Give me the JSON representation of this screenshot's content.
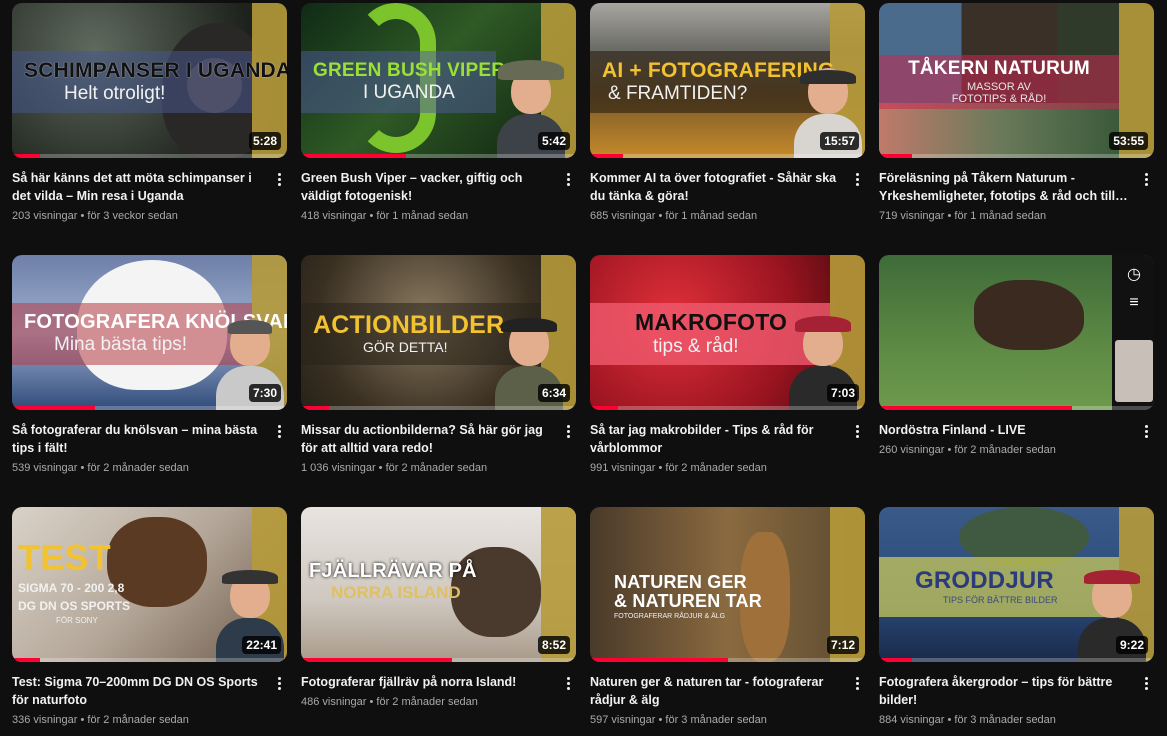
{
  "videos": [
    {
      "title": "Så här känns det att möta schimpanser i det vilda – Min resa i Uganda",
      "views": "203 visningar",
      "age": "för 3 veckor sedan",
      "duration": "5:28",
      "thumb_line1": "SCHIMPANSER I UGANDA",
      "thumb_line2": "Helt otroligt!",
      "progress": 0.1
    },
    {
      "title": "Green Bush Viper – vacker, giftig och väldigt fotogenisk!",
      "views": "418 visningar",
      "age": "för 1 månad sedan",
      "duration": "5:42",
      "thumb_line1": "GREEN BUSH VIPER",
      "thumb_line2": "I UGANDA",
      "progress": 0.38
    },
    {
      "title": "Kommer AI ta över fotografiet - Såhär ska du tänka & göra!",
      "views": "685 visningar",
      "age": "för 1 månad sedan",
      "duration": "15:57",
      "thumb_line1": "AI + FOTOGRAFERING",
      "thumb_line2": "& FRAMTIDEN?",
      "progress": 0.12
    },
    {
      "title": "Föreläsning på Tåkern Naturum - Yrkeshemligheter, fototips & råd och till din…",
      "views": "719 visningar",
      "age": "för 1 månad sedan",
      "duration": "53:55",
      "thumb_line1": "TÅKERN NATURUM",
      "thumb_line2": "MASSOR AV FOTOTIPS & RÅD!",
      "progress": 0.12
    },
    {
      "title": "Så fotograferar du knölsvan – mina bästa tips i fält!",
      "views": "539 visningar",
      "age": "för 2 månader sedan",
      "duration": "7:30",
      "thumb_line1": "FOTOGRAFERA KNÖLSVAN",
      "thumb_line2": "Mina bästa tips!",
      "progress": 0.3
    },
    {
      "title": "Missar du actionbilderna? Så här gör jag för att alltid vara redo!",
      "views": "1 036 visningar",
      "age": "för 2 månader sedan",
      "duration": "6:34",
      "thumb_line1": "ACTIONBILDER",
      "thumb_line2": "GÖR DETTA!",
      "progress": 0.1
    },
    {
      "title": "Så tar jag makrobilder - Tips & råd för vårblommor",
      "views": "991 visningar",
      "age": "för 2 månader sedan",
      "duration": "7:03",
      "thumb_line1": "MAKROFOTO",
      "thumb_line2": "tips & råd!",
      "progress": 0.1
    },
    {
      "title": "Nordöstra Finland - LIVE",
      "views": "260 visningar",
      "age": "för 2 månader sedan",
      "duration": "",
      "thumb_line1": "",
      "thumb_line2": "",
      "progress": 0.7
    },
    {
      "title": "Test: Sigma 70–200mm DG DN OS Sports för naturfoto",
      "views": "336 visningar",
      "age": "för 2 månader sedan",
      "duration": "22:41",
      "thumb_line1": "TEST",
      "thumb_line2": "SIGMA 70 - 200 2,8 DG DN OS SPORTS",
      "thumb_line3": "FÖR SONY",
      "progress": 0.1
    },
    {
      "title": "Fotograferar fjällräv på norra Island!",
      "views": "486 visningar",
      "age": "för 2 månader sedan",
      "duration": "8:52",
      "thumb_line1": "FJÄLLRÄVAR PÅ",
      "thumb_line2": "NORRA ISLAND",
      "progress": 0.55
    },
    {
      "title": "Naturen ger & naturen tar - fotograferar rådjur & älg",
      "views": "597 visningar",
      "age": "för 3 månader sedan",
      "duration": "7:12",
      "thumb_line1": "NATUREN GER",
      "thumb_line2": "& NATUREN TAR",
      "thumb_line3": "FOTOGRAFERAR RÅDJUR & ÄLG",
      "progress": 0.5
    },
    {
      "title": "Fotografera åkergrodor – tips för bättre bilder!",
      "views": "884 visningar",
      "age": "för 3 månader sedan",
      "duration": "9:22",
      "thumb_line1": "GRODDJUR",
      "thumb_line2": "TIPS FÖR BÄTTRE BILDER",
      "progress": 0.12
    }
  ],
  "colors": {
    "background": "#0f0f0f",
    "progress": "#ff0033",
    "meta_text": "#aaaaaa",
    "title_text": "#f1f1f1"
  },
  "icons": {
    "more": "more-vert-icon",
    "clock": "watch-later-icon",
    "queue": "add-to-queue-icon"
  }
}
